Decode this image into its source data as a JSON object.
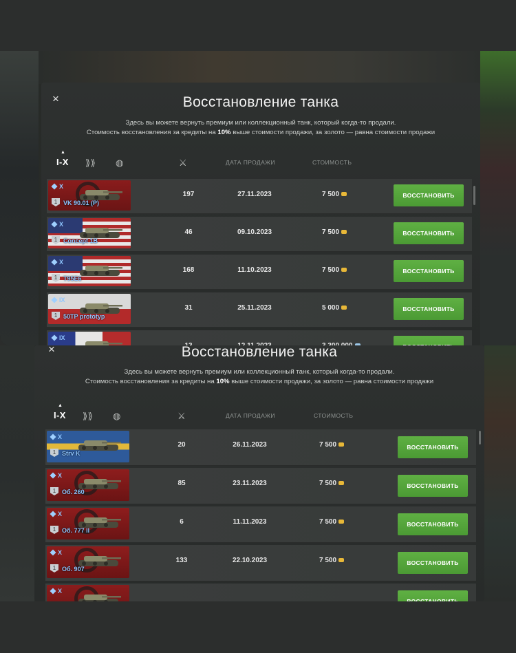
{
  "dialog": {
    "title": "Восстановление танка",
    "desc_line1": "Здесь вы можете вернуть премиум или коллекционный танк, который когда-то продали.",
    "desc_line2_a": "Стоимость восстановления за кредиты на ",
    "desc_line2_b": "10%",
    "desc_line2_c": " выше стоимости продажи, за золото — равна стоимости продажи",
    "close": "×"
  },
  "header": {
    "tier_filter": "I-X",
    "col_date": "ДАТА ПРОДАЖИ",
    "col_cost": "СТОИМОСТЬ"
  },
  "restore_label": "ВОССТАНОВИТЬ",
  "list1": [
    {
      "tier": "X",
      "name": "VK 90.01 (P)",
      "battles": "197",
      "date": "27.11.2023",
      "price": "7 500",
      "currency": "credits",
      "flag": "de"
    },
    {
      "tier": "X",
      "name": "Concept 1B",
      "battles": "46",
      "date": "09.10.2023",
      "price": "7 500",
      "currency": "credits",
      "flag": "us"
    },
    {
      "tier": "X",
      "name": "T95E6",
      "battles": "168",
      "date": "11.10.2023",
      "price": "7 500",
      "currency": "credits",
      "flag": "us"
    },
    {
      "tier": "IX",
      "name": "50TP prototyp",
      "battles": "31",
      "date": "25.11.2023",
      "price": "5 000",
      "currency": "credits",
      "flag": "pl"
    },
    {
      "tier": "IX",
      "name": "",
      "battles": "13",
      "date": "12.11.2023",
      "price": "3 300 000",
      "currency": "gold",
      "flag": "fr"
    }
  ],
  "list2": [
    {
      "tier": "X",
      "name": "Strv K",
      "battles": "20",
      "date": "26.11.2023",
      "price": "7 500",
      "currency": "credits",
      "flag": "se"
    },
    {
      "tier": "X",
      "name": "Об. 260",
      "battles": "85",
      "date": "23.11.2023",
      "price": "7 500",
      "currency": "credits",
      "flag": "su"
    },
    {
      "tier": "X",
      "name": "Об. 777 II",
      "battles": "6",
      "date": "11.11.2023",
      "price": "7 500",
      "currency": "credits",
      "flag": "su"
    },
    {
      "tier": "X",
      "name": "Об. 907",
      "battles": "133",
      "date": "22.10.2023",
      "price": "7 500",
      "currency": "credits",
      "flag": "su"
    },
    {
      "tier": "X",
      "name": "",
      "battles": "",
      "date": "",
      "price": "",
      "currency": "credits",
      "flag": "de"
    }
  ]
}
